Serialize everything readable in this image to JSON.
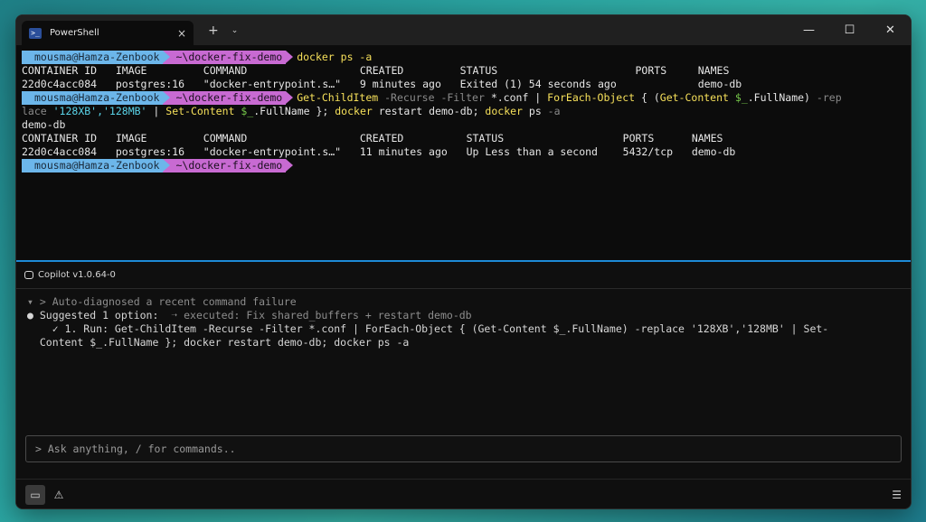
{
  "window": {
    "tab_title": "PowerShell",
    "tab_icon": ">_",
    "close_tab": "×",
    "new_tab": "+",
    "dropdown": "⌄",
    "minimize": "—",
    "maximize": "☐",
    "close": "✕"
  },
  "terminal": {
    "prompt_user": "mousma@Hamza-Zenbook",
    "prompt_path": "~\\docker-fix-demo",
    "cmd1": "docker ps -a",
    "table1_header": "CONTAINER ID   IMAGE         COMMAND                  CREATED         STATUS                      PORTS     NAMES",
    "table1_row": "22d0c4acc084   postgres:16   \"docker-entrypoint.s…\"   9 minutes ago   Exited (1) 54 seconds ago             demo-db",
    "cmd2": {
      "p1": "Get-ChildItem",
      "p2": " -Recurse -Filter ",
      "p3": "*.conf | ",
      "p4": "ForEach-Object",
      "p5": " { (",
      "p6": "Get-Content",
      "p7": " ",
      "p8": "$_",
      "p9": ".FullName) ",
      "p10": "-rep",
      "p11": "lace ",
      "p12": "'128XB','128MB'",
      "p13": " | ",
      "p14": "Set-Content",
      "p15": " ",
      "p16": "$_",
      "p17": ".FullName }; ",
      "p18": "docker",
      "p19": " restart demo-db; ",
      "p20": "docker",
      "p21": " ps ",
      "p22": "-a"
    },
    "cmd2_tail": "demo-db",
    "table2_header": "CONTAINER ID   IMAGE         COMMAND                  CREATED          STATUS                   PORTS      NAMES",
    "table2_row": "22d0c4acc084   postgres:16   \"docker-entrypoint.s…\"   11 minutes ago   Up Less than a second    5432/tcp   demo-db"
  },
  "copilot": {
    "title": "Copilot v1.0.64-0",
    "diag_line": "▾ > Auto-diagnosed a recent command failure",
    "suggested_label": "● Suggested 1 option:",
    "executed_note": "  ➝ executed: Fix shared_buffers + restart demo-db",
    "option_line1": "    ✓ 1. Run: Get-ChildItem -Recurse -Filter *.conf | ForEach-Object { (Get-Content $_.FullName) -replace '128XB','128MB' | Set-",
    "option_line2": "  Content $_.FullName }; docker restart demo-db; docker ps -a",
    "ask_placeholder": "> Ask anything, / for commands.."
  },
  "statusbar": {
    "terminal_icon": "▭",
    "warning_icon": "⚠",
    "list_icon": "☰"
  },
  "colors": {
    "user_segment": "#6cb6ea",
    "path_segment": "#c86ad2",
    "command": "#f6e05a",
    "divider": "#1d8ad6"
  }
}
